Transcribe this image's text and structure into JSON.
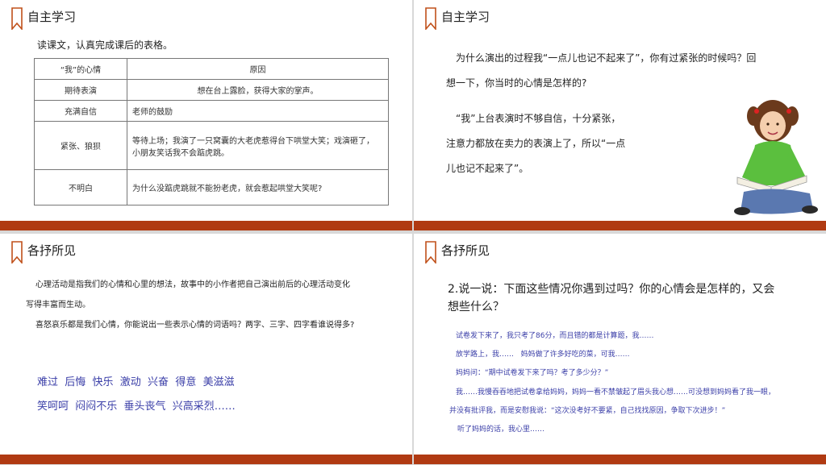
{
  "slide1": {
    "title": "自主学习",
    "instruction": "读课文，认真完成课后的表格。",
    "table": {
      "headers": [
        "“我”的心情",
        "原因"
      ],
      "rows": [
        {
          "mood": "期待表演",
          "reason_lines": [
            "想在台上露脸，获得大家的掌声。"
          ]
        },
        {
          "mood": "充满自信",
          "reason_lines": [
            "老师的鼓励"
          ]
        },
        {
          "mood": "紧张、狼狈",
          "reason_lines": [
            "等待上场；我演了一只窝囊的大老虎惹得台下哄堂大笑；戏演砸了，",
            "小朋友笑话我不会踮虎跳。"
          ]
        },
        {
          "mood": "不明白",
          "reason_lines": [
            "为什么没踮虎跳就不能扮老虎，就会惹起哄堂大笑呢?"
          ]
        }
      ]
    }
  },
  "slide2": {
    "title": "自主学习",
    "question_lines": [
      "为什么演出的过程我“一点儿也记不起来了”，你有过紧张的时候吗？回",
      "想一下，你当时的心情是怎样的?"
    ],
    "answer_lines": [
      "“我”上台表演时不够自信，十分紧张，",
      "注意力都放在卖力的表演上了，所以“一点",
      "儿也记不起来了”。"
    ]
  },
  "slide3": {
    "title": "各抒所见",
    "para_lines": [
      "心理活动是指我们的心情和心里的想法，故事中的小作者把自己演出前后的心理活动变化",
      "写得丰富而生动。",
      "喜怒哀乐都是我们心情，你能说出一些表示心情的词语吗？两字、三字、四字看谁说得多?"
    ],
    "words_line1": "难过  后悔  快乐  激动  兴奋  得意  美滋滋",
    "words_line2": "笑呵呵  闷闷不乐  垂头丧气  兴高采烈……"
  },
  "slide4": {
    "title": "各抒所见",
    "heading_lines": [
      "2.说一说：下面这些情况你遇到过吗？你的心情会是怎样的，又会",
      "想些什么？"
    ],
    "scenario_lines": [
      "试卷发下来了，我只考了86分，而且错的都是计算题，我……",
      "放学路上，我……   妈妈做了许多好吃的菜，可我……",
      "妈妈问：“期中试卷发下来了吗？考了多少分？”",
      "我……我慢吞吞地把试卷拿给妈妈，妈妈一看不禁皱起了眉头我心想……可没想到妈妈看了我一眼，",
      "并没有批评我，而是安慰我说：“这次没考好不要紧，自己找找原因，争取下次进步！”",
      "听了妈妈的话，我心里……"
    ]
  },
  "colors": {
    "accent": "#b03a12",
    "blue_text": "#3b3fa8"
  },
  "icons": {
    "bookmark": "bookmark-icon",
    "girl": "girl-reading-illustration"
  }
}
